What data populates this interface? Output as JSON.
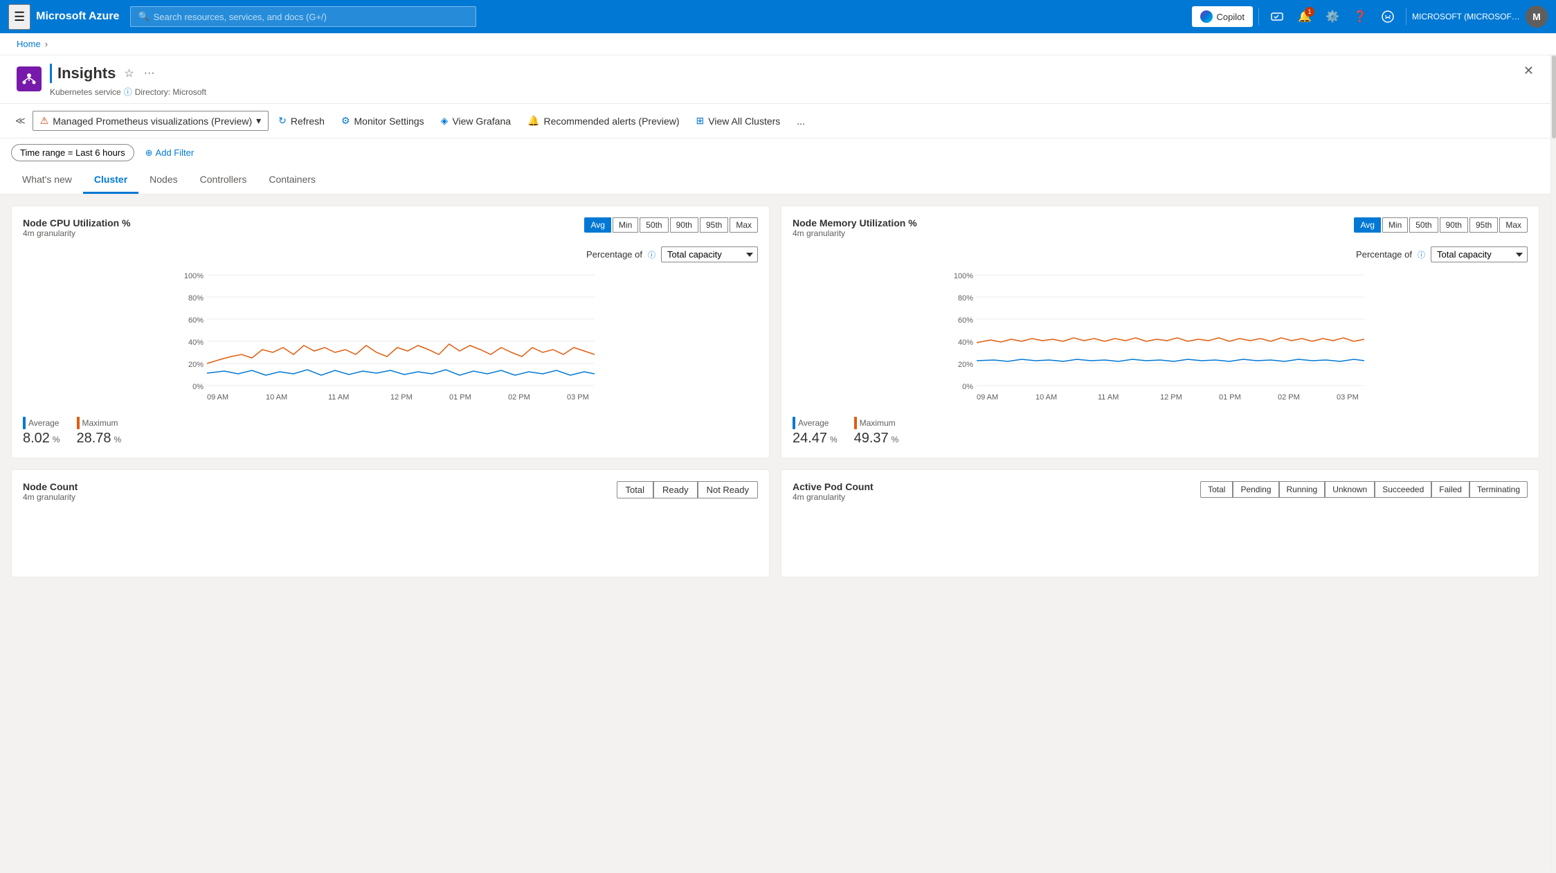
{
  "topbar": {
    "menu_label": "☰",
    "logo": "Microsoft Azure",
    "search_placeholder": "Search resources, services, and docs (G+/)",
    "copilot_label": "Copilot",
    "notification_count": "1",
    "account_label": "MICROSOFT (MICROSOFT.ONMI...",
    "avatar_initials": "M"
  },
  "breadcrumb": {
    "home": "Home",
    "separator": "›"
  },
  "page_header": {
    "title": "Insights",
    "subtitle_prefix": "ⓘ",
    "subtitle": "Directory: Microsoft",
    "service_type": "Kubernetes service"
  },
  "toolbar": {
    "prometheus_label": "Managed Prometheus visualizations (Preview)",
    "refresh_label": "Refresh",
    "monitor_settings_label": "Monitor Settings",
    "view_grafana_label": "View Grafana",
    "recommended_alerts_label": "Recommended alerts (Preview)",
    "view_all_clusters_label": "View All Clusters",
    "more_label": "..."
  },
  "filter_bar": {
    "time_range_label": "Time range = Last 6 hours",
    "add_filter_label": "Add Filter"
  },
  "tabs": [
    {
      "label": "What's new",
      "active": false
    },
    {
      "label": "Cluster",
      "active": true
    },
    {
      "label": "Nodes",
      "active": false
    },
    {
      "label": "Controllers",
      "active": false
    },
    {
      "label": "Containers",
      "active": false
    }
  ],
  "cpu_chart": {
    "title": "Node CPU Utilization %",
    "subtitle": "4m granularity",
    "controls": [
      "Avg",
      "Min",
      "50th",
      "90th",
      "95th",
      "Max"
    ],
    "active_control": "Avg",
    "percentage_label": "Percentage of",
    "dropdown_label": "Total capacity",
    "y_labels": [
      "100%",
      "80%",
      "60%",
      "40%",
      "20%",
      "0%"
    ],
    "x_labels": [
      "09 AM",
      "10 AM",
      "11 AM",
      "12 PM",
      "01 PM",
      "02 PM",
      "03 PM"
    ],
    "legend": {
      "average_label": "Average",
      "average_value": "8.02",
      "average_unit": "%",
      "maximum_label": "Maximum",
      "maximum_value": "28.78",
      "maximum_unit": "%"
    }
  },
  "memory_chart": {
    "title": "Node Memory Utilization %",
    "subtitle": "4m granularity",
    "controls": [
      "Avg",
      "Min",
      "50th",
      "90th",
      "95th",
      "Max"
    ],
    "active_control": "Avg",
    "percentage_label": "Percentage of",
    "dropdown_label": "Total capacity",
    "y_labels": [
      "100%",
      "80%",
      "60%",
      "40%",
      "20%",
      "0%"
    ],
    "x_labels": [
      "09 AM",
      "10 AM",
      "11 AM",
      "12 PM",
      "01 PM",
      "02 PM",
      "03 PM"
    ],
    "legend": {
      "average_label": "Average",
      "average_value": "24.47",
      "average_unit": "%",
      "maximum_label": "Maximum",
      "maximum_value": "49.37",
      "maximum_unit": "%"
    }
  },
  "node_count_chart": {
    "title": "Node Count",
    "subtitle": "4m granularity",
    "buttons": [
      "Total",
      "Ready",
      "Not Ready"
    ]
  },
  "pod_count_chart": {
    "title": "Active Pod Count",
    "subtitle": "4m granularity",
    "buttons": [
      "Total",
      "Pending",
      "Running",
      "Unknown",
      "Succeeded",
      "Failed",
      "Terminating"
    ]
  }
}
